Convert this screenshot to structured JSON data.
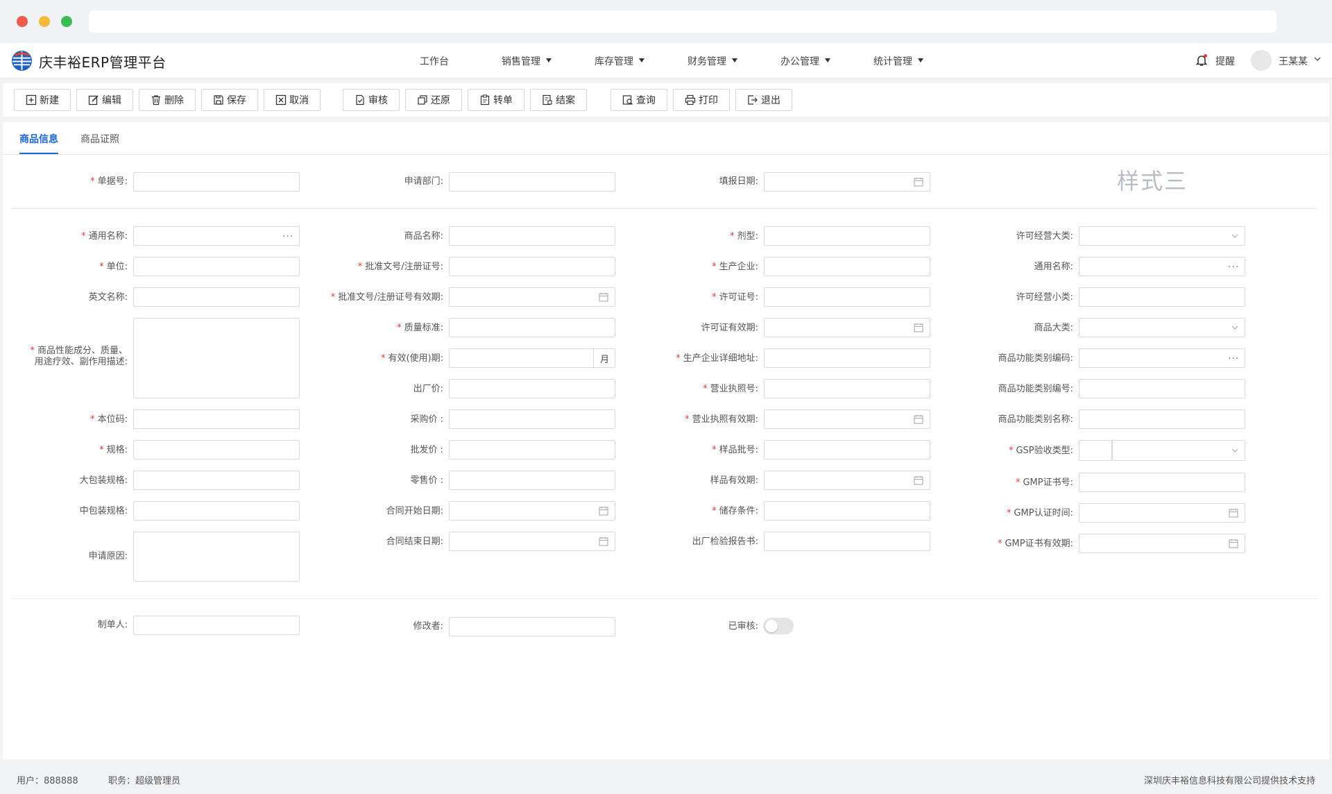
{
  "header": {
    "app_title": "庆丰裕ERP管理平台",
    "nav": [
      {
        "label": "工作台"
      },
      {
        "label": "销售管理"
      },
      {
        "label": "库存管理"
      },
      {
        "label": "财务管理"
      },
      {
        "label": "办公管理"
      },
      {
        "label": "统计管理"
      }
    ],
    "reminder_label": "提醒",
    "username": "王某某"
  },
  "toolbar": [
    {
      "label": "新建",
      "icon": "plus-square-icon"
    },
    {
      "label": "编辑",
      "icon": "edit-icon"
    },
    {
      "label": "删除",
      "icon": "trash-icon"
    },
    {
      "label": "保存",
      "icon": "save-icon"
    },
    {
      "label": "取消",
      "icon": "close-square-icon"
    },
    {
      "label": "审核",
      "icon": "audit-icon"
    },
    {
      "label": "还原",
      "icon": "restore-icon"
    },
    {
      "label": "转单",
      "icon": "transfer-icon"
    },
    {
      "label": "结案",
      "icon": "close-case-icon"
    },
    {
      "label": "查询",
      "icon": "query-icon"
    },
    {
      "label": "打印",
      "icon": "printer-icon"
    },
    {
      "label": "退出",
      "icon": "exit-icon"
    }
  ],
  "tabs": [
    {
      "label": "商品信息",
      "active": true
    },
    {
      "label": "商品证照",
      "active": false
    }
  ],
  "watermark": "样式三",
  "form": {
    "doc_no": "单据号:",
    "apply_dept": "申请部门:",
    "fill_date": "填报日期:",
    "common_name": "通用名称:",
    "goods_name": "商品名称:",
    "dosage_form": "剂型:",
    "license_category": "许可经营大类:",
    "unit": "单位:",
    "approval_no": "批准文号/注册证号:",
    "manufacturer": "生产企业:",
    "common_name_2": "通用名称:",
    "english_name": "英文名称:",
    "approval_valid": "批准文号/注册证号有效期:",
    "license_no": "许可证号:",
    "license_subcategory": "许可经营小类:",
    "description_line1": "商品性能成分、质量、",
    "description_line2": "用途疗效、副作用描述:",
    "quality_standard": "质量标准:",
    "license_valid": "许可证有效期:",
    "goods_category": "商品大类:",
    "validity_period": "有效(使用)期:",
    "validity_unit": "月",
    "manufacturer_address": "生产企业详细地址:",
    "function_category_code": "商品功能类别编码:",
    "factory_price": "出厂价:",
    "business_license_no": "营业执照号:",
    "function_category_no": "商品功能类别编号:",
    "barcode": "本位码:",
    "purchase_price": "采购价 :",
    "business_license_valid": "营业执照有效期:",
    "function_category_name": "商品功能类别名称:",
    "spec": "规格:",
    "wholesale_price": "批发价 :",
    "sample_batch": "样品批号:",
    "gsp_type": "GSP验收类型:",
    "large_pack": "大包装规格:",
    "retail_price": "零售价 :",
    "sample_valid": "样品有效期:",
    "gmp_cert_no": "GMP证书号:",
    "medium_pack": "中包装规格:",
    "contract_start": "合同开始日期:",
    "storage": "储存条件:",
    "gmp_cert_time": "GMP认证时间:",
    "contract_end": "合同结束日期:",
    "inspection_report": "出厂检验报告书:",
    "gmp_cert_valid": "GMP证书有效期:",
    "apply_reason": "申请原因:",
    "creator": "制单人:",
    "modifier": "修改者:",
    "audited": "已审核:"
  },
  "footer": {
    "user": "用户：888888",
    "role": "职务：超级管理员",
    "support": "深圳庆丰裕信息科技有限公司提供技术支持"
  },
  "colors": {
    "accent": "#1a66d9",
    "required": "#e23b3b"
  }
}
